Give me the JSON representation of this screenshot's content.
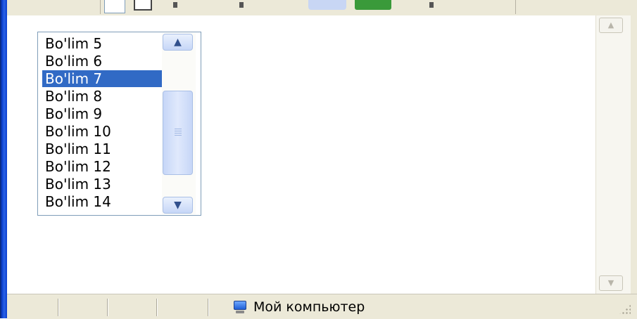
{
  "listbox": {
    "items": [
      {
        "label": "Bo'lim 5",
        "selected": false
      },
      {
        "label": "Bo'lim 6",
        "selected": false
      },
      {
        "label": "Bo'lim 7",
        "selected": true
      },
      {
        "label": "Bo'lim 8",
        "selected": false
      },
      {
        "label": "Bo'lim 9",
        "selected": false
      },
      {
        "label": "Bo'lim 10",
        "selected": false
      },
      {
        "label": "Bo'lim 11",
        "selected": false
      },
      {
        "label": "Bo'lim 12",
        "selected": false
      },
      {
        "label": "Bo'lim 13",
        "selected": false
      },
      {
        "label": "Bo'lim 14",
        "selected": false
      }
    ],
    "scroll_up_icon": "chevron-up-icon",
    "scroll_down_icon": "chevron-down-icon",
    "selected_color": "#316ac5"
  },
  "statusbar": {
    "zone_label": "Мой компьютер",
    "zone_icon": "computer-icon"
  },
  "colors": {
    "window_frame": "#0a3fd0",
    "chrome": "#ece9d8"
  }
}
